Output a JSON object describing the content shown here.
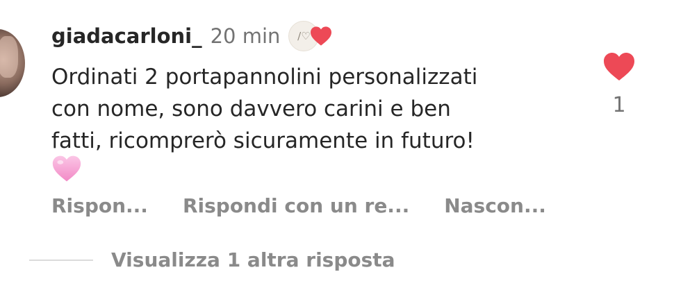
{
  "comment": {
    "username": "giadacarloni_",
    "time": "20 min",
    "badge_text": "/♡",
    "text": "Ordinati 2 portapannolini personalizzati\ncon nome, sono davvero carini e ben\nfatti, ricomprerò sicuramente in futuro!",
    "likes": "1"
  },
  "actions": {
    "reply": "Rispon...",
    "reply_with": "Rispondi con un re...",
    "hide": "Nascon..."
  },
  "replies": {
    "view_more": "Visualizza 1 altra risposta"
  },
  "colors": {
    "like_red": "#ed4956",
    "emoji_pink": "#f7a8d6",
    "secondary_text": "#8a8a8a",
    "primary_text": "#262626"
  },
  "icons": {
    "like": "heart-icon",
    "creator_like": "creator-heart-icon",
    "emoji": "pink-heart-emoji"
  }
}
